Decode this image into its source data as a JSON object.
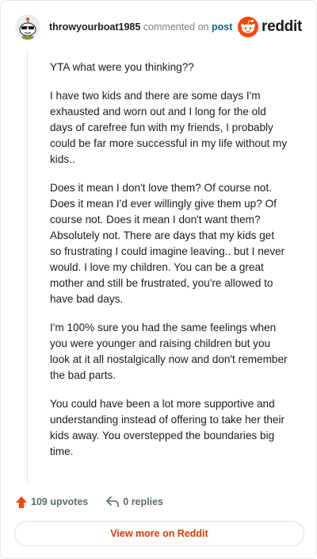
{
  "header": {
    "username": "throwyourboat1985",
    "commented_text": "commented on",
    "post_link": "post",
    "logo_text": "reddit",
    "brand_color": "#ff4500"
  },
  "comment": {
    "paragraphs": [
      "YTA what were you thinking??",
      "I have two kids and there are some days I'm exhausted and worn out and I long for the old days of carefree fun with my friends, I probably could be far more successful in my life without my kids..",
      "Does it mean I don't love them? Of course not. Does it mean I'd ever willingly give them up? Of course not. Does it mean I don't want them? Absolutely not. There are days that my kids get so frustrating I could imagine leaving.. but I never would. I love my children. You can be a great mother and still be frustrated, you're allowed to have bad days.",
      "I'm 100% sure you had the same feelings when you were younger and raising children but you look at it all nostalgically now and don't remember the bad parts.",
      "You could have been a lot more supportive and understanding instead of offering to take her their kids away. You overstepped the boundaries big time."
    ]
  },
  "actions": {
    "upvotes": "109 upvotes",
    "replies": "0 replies",
    "upvote_icon": "upvote-arrow-icon",
    "reply_icon": "reply-arrow-icon"
  },
  "footer": {
    "view_more": "View more on Reddit"
  }
}
